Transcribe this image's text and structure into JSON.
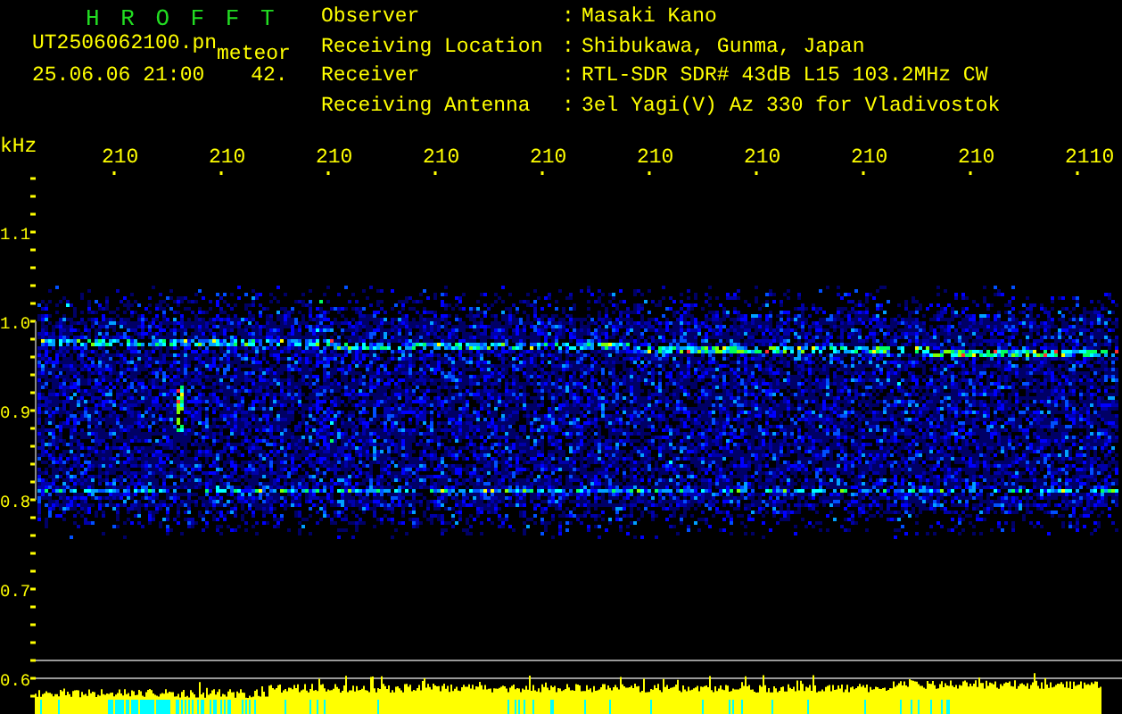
{
  "header": {
    "title": "H R O F F T",
    "filename": "UT2506062100.pn",
    "tag": "meteor",
    "datetime": "25.06.06 21:00",
    "value": "42."
  },
  "info": [
    {
      "label": "Observer",
      "colon": ":",
      "value": "Masaki Kano"
    },
    {
      "label": "Receiving Location",
      "colon": ":",
      "value": "Shibukawa, Gunma, Japan"
    },
    {
      "label": "Receiver",
      "colon": ":",
      "value": "RTL-SDR SDR# 43dB L15 103.2MHz CW"
    },
    {
      "label": "Receiving Antenna",
      "colon": ":",
      "value": "3el Yagi(V) Az 330 for Vladivostok"
    }
  ],
  "plot": {
    "y_unit": "kHz",
    "x_ticks": [
      "210",
      "210",
      "210",
      "210",
      "210",
      "210",
      "210",
      "210",
      "210",
      "2110"
    ],
    "y_ticks": [
      "1.1",
      "1.0",
      "0.9",
      "0.8",
      "0.7",
      "0.6"
    ]
  }
}
